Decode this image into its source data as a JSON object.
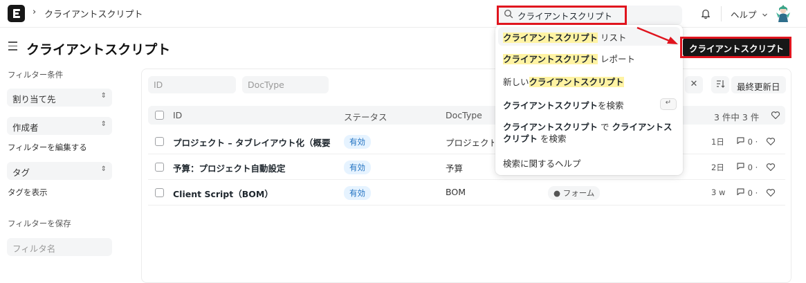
{
  "navbar": {
    "breadcrumb_sep": "›",
    "breadcrumb": "クライアントスクリプト",
    "search_value": "クライアントスクリプト",
    "help_label": "ヘルプ"
  },
  "page": {
    "title": "クライアントスクリプト",
    "primary_button": "クライアントスクリプト"
  },
  "sidebar": {
    "filter_heading": "フィルター条件",
    "assigned_to": "割り当て先",
    "created_by": "作成者",
    "edit_filters": "フィルターを編集する",
    "tags": "タグ",
    "show_tags": "タグを表示",
    "save_filter": "フィルターを保存",
    "filter_name_placeholder": "フィルタ名"
  },
  "list": {
    "filter_id_placeholder": "ID",
    "filter_doctype_placeholder": "DocType",
    "sort_label": "最終更新日",
    "columns": [
      "ID",
      "ステータス",
      "DocType"
    ],
    "count_label": "3 件中 3 件",
    "rows": [
      {
        "id": "プロジェクト – タブレイアウト化（概要",
        "status": "有効",
        "doctype": "プロジェクト",
        "tag": "",
        "time": "1日",
        "comments": "0"
      },
      {
        "id": "予算：プロジェクト自動設定",
        "status": "有効",
        "doctype": "予算",
        "tag": "",
        "time": "2日",
        "comments": "0"
      },
      {
        "id": "Client Script（BOM）",
        "status": "有効",
        "doctype": "BOM",
        "tag": "フォーム",
        "time": "3 w",
        "comments": "0"
      }
    ]
  },
  "dropdown": {
    "item1_hl": "クライアントスクリプト",
    "item1_rest": " リスト",
    "item2_hl": "クライアントスクリプト",
    "item2_rest": " レポート",
    "item3_pre": "新しい",
    "item3_hl": "クライアントスクリプト",
    "item4_b": "クライアントスクリプト",
    "item4_rest": "を検索",
    "item4_key": "↵",
    "item5_b1": "クライアントスクリプト",
    "item5_mid": " で ",
    "item5_b2": "クライアントスクリプト",
    "item5_rest": " を検索",
    "item6": "検索に関するヘルプ"
  },
  "colors": {
    "accent": "#171717",
    "highlight": "#fff3a3",
    "annotation_red": "#e0141e",
    "badge_blue": "#1f70c1"
  }
}
